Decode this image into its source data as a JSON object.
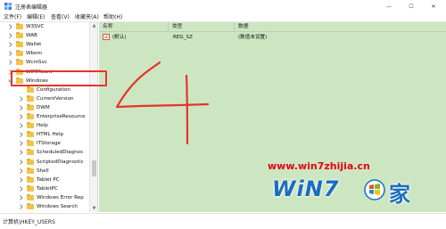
{
  "window": {
    "title": "注册表编辑器",
    "minimize_glyph": "—",
    "maximize_glyph": "☐",
    "close_glyph": "✕"
  },
  "menu": {
    "items": [
      "文件(F)",
      "编辑(E)",
      "查看(V)",
      "收藏夹(A)",
      "帮助(H)"
    ]
  },
  "tree": {
    "items": [
      {
        "label": "W3SVC",
        "level": 1,
        "expandable": true
      },
      {
        "label": "WAB",
        "level": 1,
        "expandable": true
      },
      {
        "label": "Wallet",
        "level": 1,
        "expandable": true
      },
      {
        "label": "Wbem",
        "level": 1,
        "expandable": true
      },
      {
        "label": "WcmSvc",
        "level": 1,
        "expandable": true
      },
      {
        "label": "WIMMount",
        "level": 1,
        "expandable": true
      },
      {
        "label": "Windows",
        "level": 1,
        "expandable": true,
        "expanded": true,
        "selected": true
      },
      {
        "label": "Configuration",
        "level": 2,
        "expandable": false
      },
      {
        "label": "CurrentVersion",
        "level": 2,
        "expandable": true
      },
      {
        "label": "DWM",
        "level": 2,
        "expandable": true
      },
      {
        "label": "EnterpriseResource",
        "level": 2,
        "expandable": true
      },
      {
        "label": "Help",
        "level": 2,
        "expandable": true
      },
      {
        "label": "HTML Help",
        "level": 2,
        "expandable": true
      },
      {
        "label": "ITStorage",
        "level": 2,
        "expandable": true
      },
      {
        "label": "ScheduledDiagnos",
        "level": 2,
        "expandable": true
      },
      {
        "label": "ScriptedDiagnostic",
        "level": 2,
        "expandable": true
      },
      {
        "label": "Shell",
        "level": 2,
        "expandable": true
      },
      {
        "label": "Tablet PC",
        "level": 2,
        "expandable": true
      },
      {
        "label": "TabletPC",
        "level": 2,
        "expandable": true
      },
      {
        "label": "Windows Error Rep",
        "level": 2,
        "expandable": true
      },
      {
        "label": "Windows Search",
        "level": 2,
        "expandable": true
      }
    ]
  },
  "values_table": {
    "headers": {
      "name": "名称",
      "type": "类型",
      "data": "数据"
    },
    "rows": [
      {
        "icon": "ab",
        "name": "(默认)",
        "type": "REG_SZ",
        "data": "(数值未设置)"
      }
    ]
  },
  "statusbar": {
    "path": "计算机\\HKEY_USERS"
  },
  "watermark": {
    "url": "www.win7zhijia.cn",
    "brand_text": "WiN7",
    "brand_char": "家"
  },
  "colors": {
    "highlight_box": "#e8332d",
    "right_pane_bg": "#cde6c2",
    "annotation_stroke": "#e8332d",
    "watermark_url": "#e60012",
    "watermark_brand": "#1b6dc0"
  },
  "annotation": {
    "drawn_numeral": "4"
  }
}
